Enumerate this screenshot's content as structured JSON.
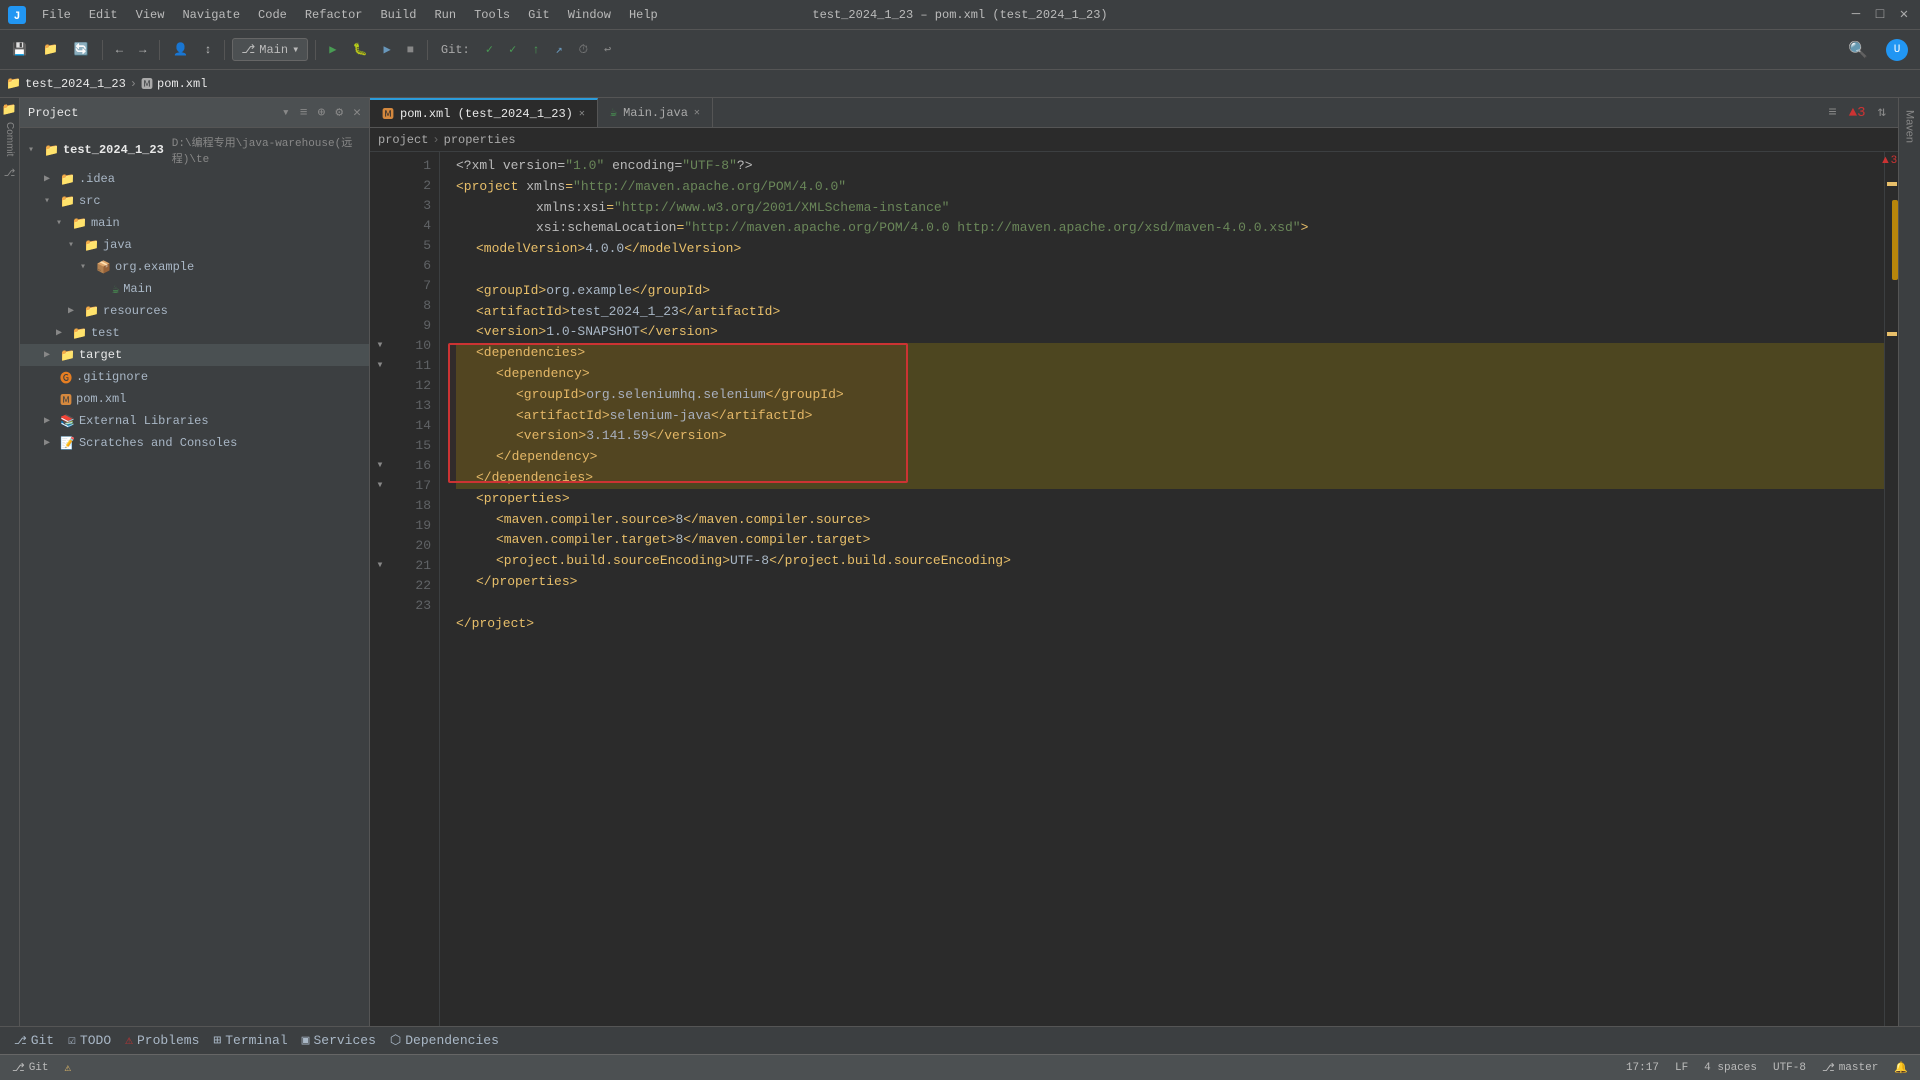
{
  "window": {
    "title": "test_2024_1_23 – pom.xml (test_2024_1_23)"
  },
  "menu": {
    "items": [
      "File",
      "Edit",
      "View",
      "Navigate",
      "Code",
      "Refactor",
      "Build",
      "Run",
      "Tools",
      "Git",
      "Window",
      "Help"
    ]
  },
  "toolbar": {
    "branch": "Main",
    "run_label": "▶",
    "debug_label": "🐛",
    "git_label": "Git:"
  },
  "tabs": {
    "project_tab": "pom.xml (test_2024_1_23)",
    "main_tab": "Main.java"
  },
  "project_panel": {
    "title": "Project",
    "root": "test_2024_1_23",
    "root_path": "D:\\编程专用\\java-warehouse(远程)\\te",
    "items": [
      {
        "id": "idea",
        "label": ".idea",
        "type": "folder",
        "indent": 1
      },
      {
        "id": "src",
        "label": "src",
        "type": "folder",
        "indent": 1
      },
      {
        "id": "main",
        "label": "main",
        "type": "folder",
        "indent": 2
      },
      {
        "id": "java",
        "label": "java",
        "type": "folder",
        "indent": 3
      },
      {
        "id": "org_example",
        "label": "org.example",
        "type": "folder-blue",
        "indent": 4
      },
      {
        "id": "Main",
        "label": "Main",
        "type": "java",
        "indent": 5
      },
      {
        "id": "resources",
        "label": "resources",
        "type": "folder",
        "indent": 3
      },
      {
        "id": "test",
        "label": "test",
        "type": "folder",
        "indent": 2
      },
      {
        "id": "target",
        "label": "target",
        "type": "folder-orange",
        "indent": 1
      },
      {
        "id": "gitignore",
        "label": ".gitignore",
        "type": "git",
        "indent": 1
      },
      {
        "id": "pom",
        "label": "pom.xml",
        "type": "maven",
        "indent": 1
      }
    ],
    "external_libraries": "External Libraries",
    "scratches": "Scratches and Consoles"
  },
  "editor": {
    "filename": "pom.xml",
    "lines": [
      {
        "num": 1,
        "content": "<?xml version=\"1.0\" encoding=\"UTF-8\"?>"
      },
      {
        "num": 2,
        "content": "<project xmlns=\"http://maven.apache.org/POM/4.0.0\""
      },
      {
        "num": 3,
        "content": "         xmlns:xsi=\"http://www.w3.org/2001/XMLSchema-instance\""
      },
      {
        "num": 4,
        "content": "         xsi:schemaLocation=\"http://maven.apache.org/POM/4.0.0 http://maven.apache.org/xsd/maven-4.0.0.xsd\">"
      },
      {
        "num": 5,
        "content": "    <modelVersion>4.0.0</modelVersion>"
      },
      {
        "num": 6,
        "content": ""
      },
      {
        "num": 7,
        "content": "    <groupId>org.example</groupId>"
      },
      {
        "num": 8,
        "content": "    <artifactId>test_2024_1_23</artifactId>"
      },
      {
        "num": 9,
        "content": "    <version>1.0-SNAPSHOT</version>"
      },
      {
        "num": 10,
        "content": "    <dependencies>"
      },
      {
        "num": 11,
        "content": "        <dependency>"
      },
      {
        "num": 12,
        "content": "            <groupId>org.seleniumhq.selenium</groupId>"
      },
      {
        "num": 13,
        "content": "            <artifactId>selenium-java</artifactId>"
      },
      {
        "num": 14,
        "content": "            <version>3.141.59</version>"
      },
      {
        "num": 15,
        "content": "        </dependency>"
      },
      {
        "num": 16,
        "content": "    </dependencies>"
      },
      {
        "num": 17,
        "content": "    <properties>"
      },
      {
        "num": 18,
        "content": "        <maven.compiler.source>8</maven.compiler.source>"
      },
      {
        "num": 19,
        "content": "        <maven.compiler.target>8</maven.compiler.target>"
      },
      {
        "num": 20,
        "content": "        <project.build.sourceEncoding>UTF-8</project.build.sourceEncoding>"
      },
      {
        "num": 21,
        "content": "    </properties>"
      },
      {
        "num": 22,
        "content": ""
      },
      {
        "num": 23,
        "content": "</project>"
      }
    ]
  },
  "breadcrumb": {
    "items": [
      "project",
      "properties"
    ]
  },
  "bottom_tabs": {
    "git": "Git",
    "todo": "TODO",
    "problems": "Problems",
    "terminal": "Terminal",
    "services": "Services",
    "dependencies": "Dependencies"
  },
  "status": {
    "position": "17:17",
    "line_sep": "LF",
    "indent": "4 spaces",
    "branch": "master",
    "errors": "3"
  }
}
